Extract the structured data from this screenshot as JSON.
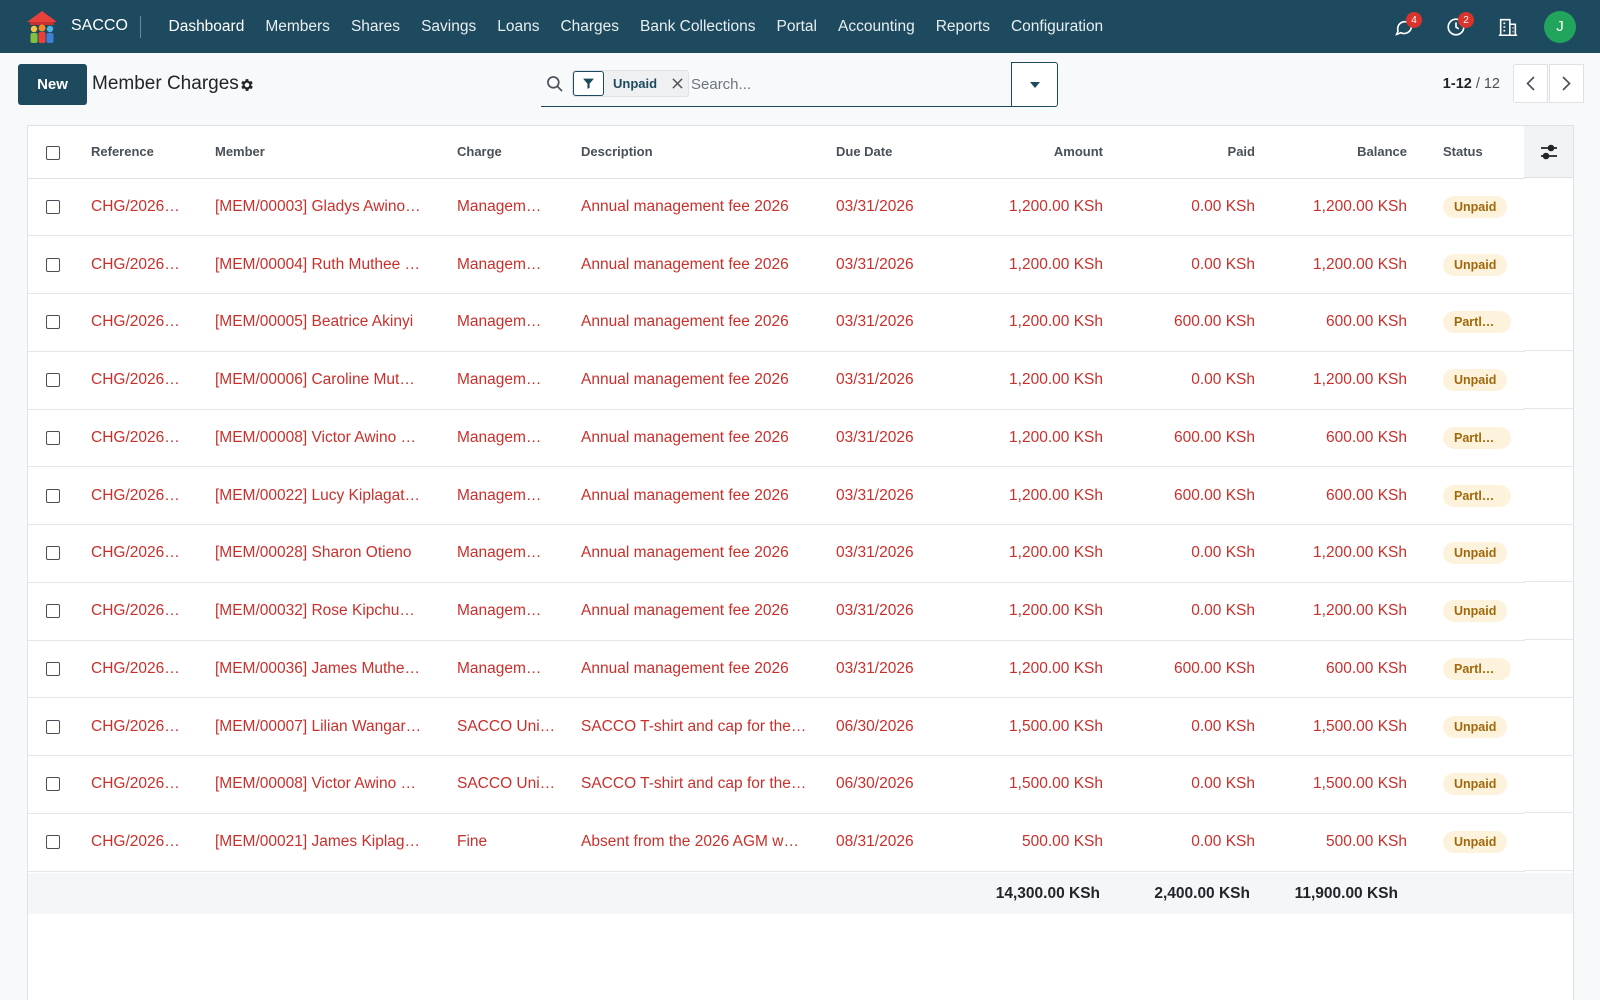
{
  "navbar": {
    "app_name": "SACCO",
    "menu": [
      "Dashboard",
      "Members",
      "Shares",
      "Savings",
      "Loans",
      "Charges",
      "Bank Collections",
      "Portal",
      "Accounting",
      "Reports",
      "Configuration"
    ],
    "messages_count": "4",
    "activities_count": "2",
    "avatar_initial": "J",
    "accent_color": "#1d4a5e",
    "avatar_color": "#21a55d"
  },
  "control_panel": {
    "new_label": "New",
    "title": "Member Charges",
    "search": {
      "facet_value": "Unpaid",
      "placeholder": "Search..."
    },
    "pager": {
      "value": "1-12",
      "separator": "/",
      "limit": "12"
    }
  },
  "table": {
    "columns": {
      "reference": "Reference",
      "member": "Member",
      "charge": "Charge",
      "description": "Description",
      "due_date": "Due Date",
      "amount": "Amount",
      "paid": "Paid",
      "balance": "Balance",
      "status": "Status"
    },
    "rows": [
      {
        "reference": "CHG/2026…",
        "member": "[MEM/00003] Gladys Awino…",
        "charge": "Managem…",
        "description": "Annual management fee 2026",
        "due_date": "03/31/2026",
        "amount": "1,200.00 KSh",
        "paid": "0.00 KSh",
        "balance": "1,200.00 KSh",
        "status": "Unpaid"
      },
      {
        "reference": "CHG/2026…",
        "member": "[MEM/00004] Ruth Muthee …",
        "charge": "Managem…",
        "description": "Annual management fee 2026",
        "due_date": "03/31/2026",
        "amount": "1,200.00 KSh",
        "paid": "0.00 KSh",
        "balance": "1,200.00 KSh",
        "status": "Unpaid"
      },
      {
        "reference": "CHG/2026…",
        "member": "[MEM/00005] Beatrice Akinyi",
        "charge": "Managem…",
        "description": "Annual management fee 2026",
        "due_date": "03/31/2026",
        "amount": "1,200.00 KSh",
        "paid": "600.00 KSh",
        "balance": "600.00 KSh",
        "status": "Partly…"
      },
      {
        "reference": "CHG/2026…",
        "member": "[MEM/00006] Caroline Mut…",
        "charge": "Managem…",
        "description": "Annual management fee 2026",
        "due_date": "03/31/2026",
        "amount": "1,200.00 KSh",
        "paid": "0.00 KSh",
        "balance": "1,200.00 KSh",
        "status": "Unpaid"
      },
      {
        "reference": "CHG/2026…",
        "member": "[MEM/00008] Victor Awino …",
        "charge": "Managem…",
        "description": "Annual management fee 2026",
        "due_date": "03/31/2026",
        "amount": "1,200.00 KSh",
        "paid": "600.00 KSh",
        "balance": "600.00 KSh",
        "status": "Partly…"
      },
      {
        "reference": "CHG/2026…",
        "member": "[MEM/00022] Lucy Kiplagat…",
        "charge": "Managem…",
        "description": "Annual management fee 2026",
        "due_date": "03/31/2026",
        "amount": "1,200.00 KSh",
        "paid": "600.00 KSh",
        "balance": "600.00 KSh",
        "status": "Partly…"
      },
      {
        "reference": "CHG/2026…",
        "member": "[MEM/00028] Sharon Otieno",
        "charge": "Managem…",
        "description": "Annual management fee 2026",
        "due_date": "03/31/2026",
        "amount": "1,200.00 KSh",
        "paid": "0.00 KSh",
        "balance": "1,200.00 KSh",
        "status": "Unpaid"
      },
      {
        "reference": "CHG/2026…",
        "member": "[MEM/00032] Rose Kipchu…",
        "charge": "Managem…",
        "description": "Annual management fee 2026",
        "due_date": "03/31/2026",
        "amount": "1,200.00 KSh",
        "paid": "0.00 KSh",
        "balance": "1,200.00 KSh",
        "status": "Unpaid"
      },
      {
        "reference": "CHG/2026…",
        "member": "[MEM/00036] James Muthe…",
        "charge": "Managem…",
        "description": "Annual management fee 2026",
        "due_date": "03/31/2026",
        "amount": "1,200.00 KSh",
        "paid": "600.00 KSh",
        "balance": "600.00 KSh",
        "status": "Partly…"
      },
      {
        "reference": "CHG/2026…",
        "member": "[MEM/00007] Lilian Wangar…",
        "charge": "SACCO Uni…",
        "description": "SACCO T-shirt and cap for the…",
        "due_date": "06/30/2026",
        "amount": "1,500.00 KSh",
        "paid": "0.00 KSh",
        "balance": "1,500.00 KSh",
        "status": "Unpaid"
      },
      {
        "reference": "CHG/2026…",
        "member": "[MEM/00008] Victor Awino …",
        "charge": "SACCO Uni…",
        "description": "SACCO T-shirt and cap for the…",
        "due_date": "06/30/2026",
        "amount": "1,500.00 KSh",
        "paid": "0.00 KSh",
        "balance": "1,500.00 KSh",
        "status": "Unpaid"
      },
      {
        "reference": "CHG/2026…",
        "member": "[MEM/00021] James Kiplag…",
        "charge": "Fine",
        "description": "Absent from the 2026 AGM w…",
        "due_date": "08/31/2026",
        "amount": "500.00 KSh",
        "paid": "0.00 KSh",
        "balance": "500.00 KSh",
        "status": "Unpaid"
      }
    ],
    "totals": {
      "amount": "14,300.00 KSh",
      "paid": "2,400.00 KSh",
      "balance": "11,900.00 KSh"
    },
    "link_color": "#c9302c",
    "status_color": "#a0680a"
  }
}
